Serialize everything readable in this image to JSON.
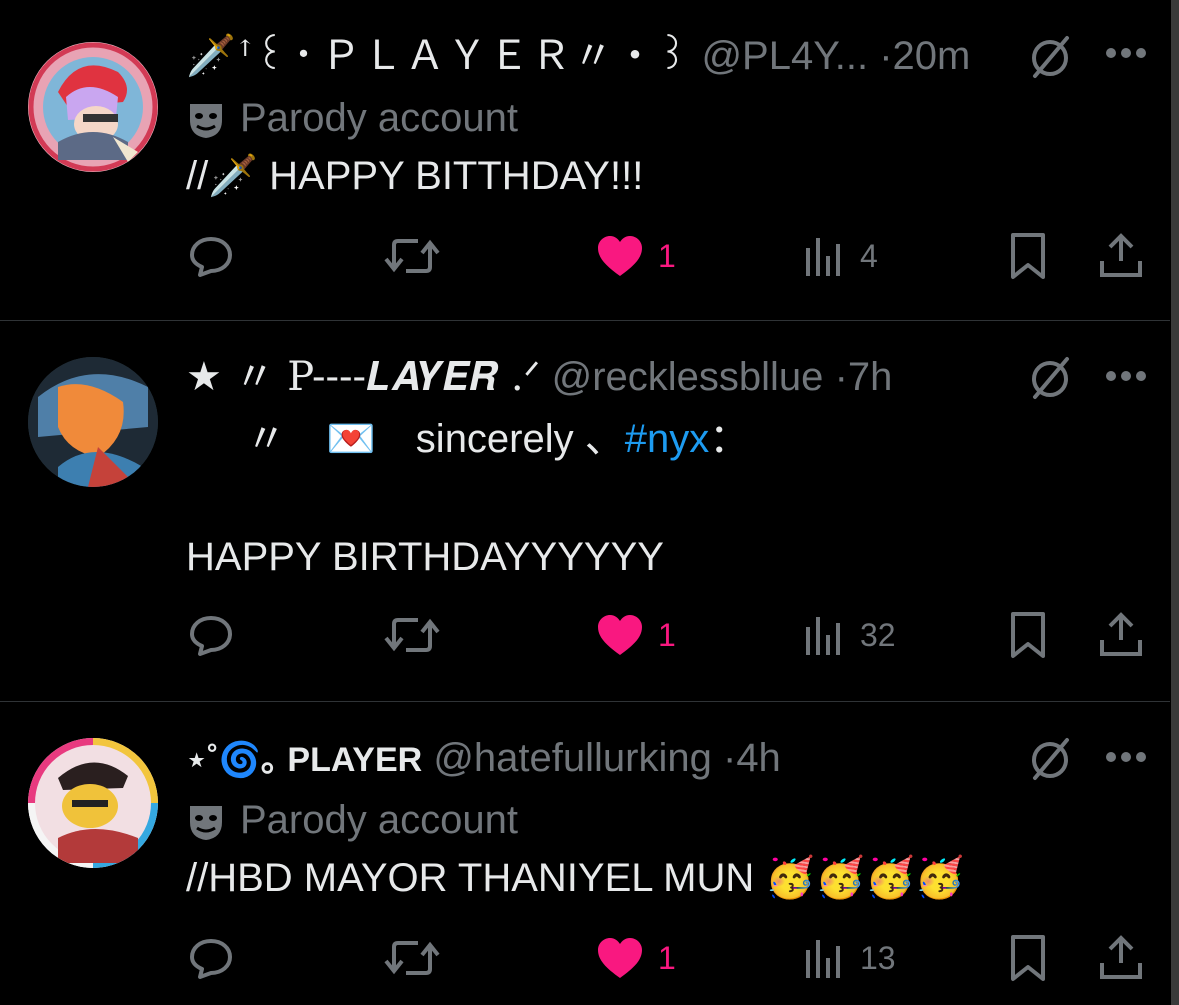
{
  "colors": {
    "background": "#000000",
    "text": "#e7e9ea",
    "muted": "#71767b",
    "like": "#f91880",
    "link": "#1d9bf0",
    "divider": "#2f3336"
  },
  "tweets": [
    {
      "display_name": "🗡️ꜛ꒰・ＰＬＡＹＥＲ〃・꒱",
      "handle": "@PL4Y...",
      "separator": "·",
      "time": "20m",
      "parody_label": "Parody account",
      "text_lines": [
        "//🗡️ HAPPY BITTHDAY!!!"
      ],
      "actions": {
        "replies": "",
        "reposts": "",
        "likes": "1",
        "views": "4",
        "liked": true
      },
      "icons": [
        "reply-icon",
        "repost-icon",
        "heart-icon",
        "views-icon",
        "bookmark-icon",
        "share-icon",
        "grok-icon",
        "more-icon",
        "mask-icon"
      ]
    },
    {
      "display_name": "★ 〃 P----𝑳𝑨𝒀𝑬𝑹 .ᐟ",
      "handle": "@recklessbllue",
      "separator": "·",
      "time": "7h",
      "text_line1_prefix": "〃　💌　sincerely 、",
      "hashtag": "#nyx",
      "text_line1_suffix": "：",
      "text_line2": "HAPPY BIRTHDAYYYYYY",
      "actions": {
        "replies": "",
        "reposts": "",
        "likes": "1",
        "views": "32",
        "liked": true
      }
    },
    {
      "display_name": "⋆˚🌀｡ PLAYER",
      "handle": "@hatefullurking",
      "separator": "·",
      "time": "4h",
      "parody_label": "Parody account",
      "text_lines": [
        "//HBD MAYOR THANIYEL MUN 🥳🥳🥳🥳"
      ],
      "actions": {
        "replies": "",
        "reposts": "",
        "likes": "1",
        "views": "13",
        "liked": true
      }
    }
  ]
}
